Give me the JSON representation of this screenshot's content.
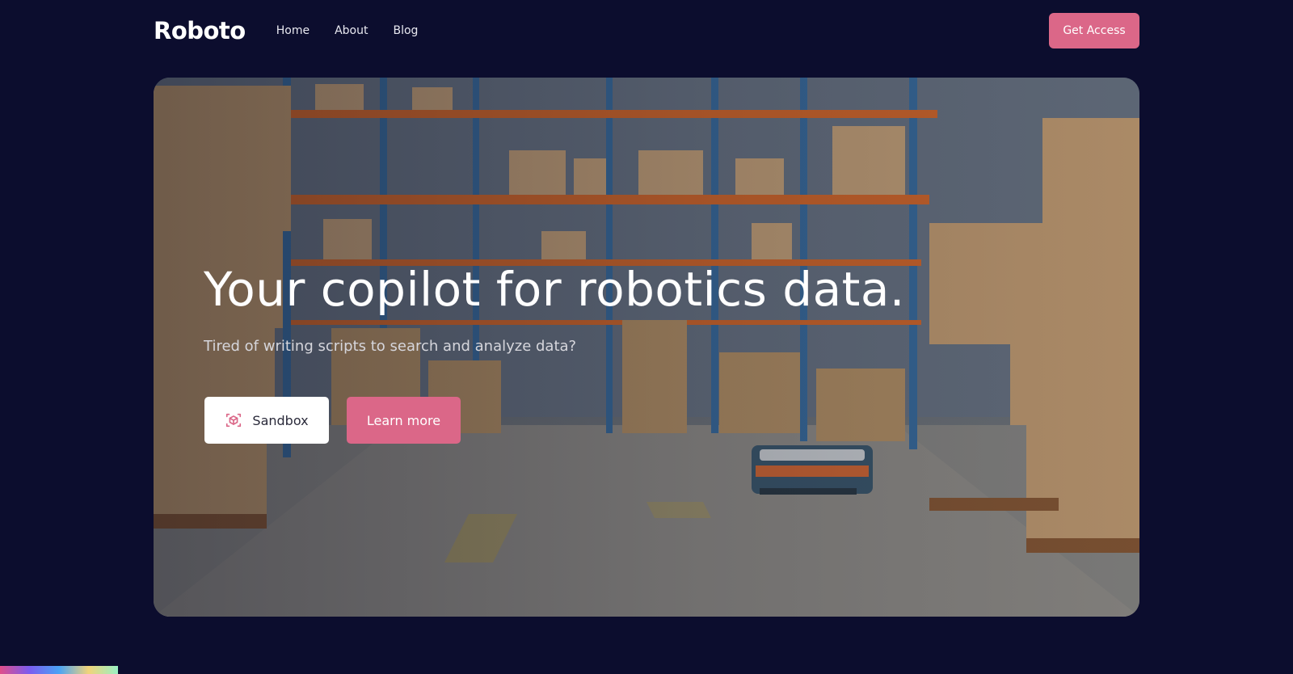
{
  "header": {
    "logo": "Roboto",
    "nav": [
      {
        "label": "Home"
      },
      {
        "label": "About"
      },
      {
        "label": "Blog"
      }
    ],
    "cta_label": "Get Access"
  },
  "hero": {
    "title": "Your copilot for robotics data.",
    "subtitle": "Tired of writing scripts to search and analyze data?",
    "sandbox_label": "Sandbox",
    "learn_more_label": "Learn more"
  },
  "colors": {
    "background": "#0c0d2e",
    "accent": "#db6788",
    "white": "#ffffff"
  },
  "icons": {
    "sandbox": "cube-scan-icon"
  }
}
